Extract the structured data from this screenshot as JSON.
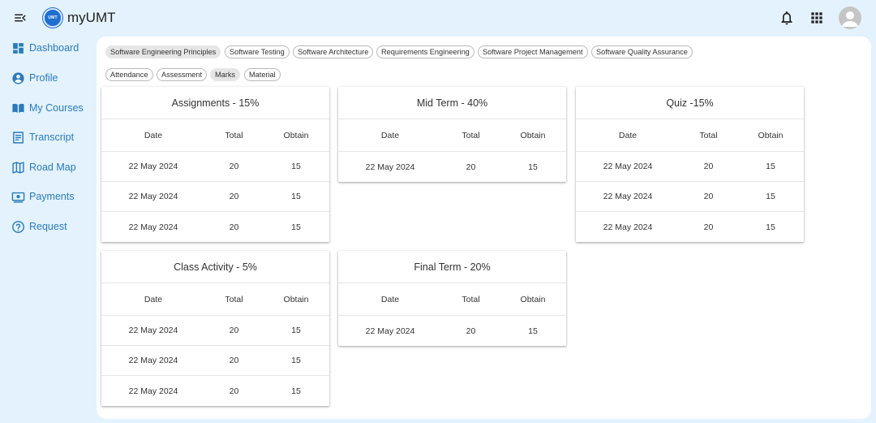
{
  "app": {
    "title": "myUMT",
    "logo_text": "UMT"
  },
  "topbar": {
    "icons": [
      "menu-toggle-icon",
      "bell-icon",
      "apps-grid-icon",
      "account-icon"
    ]
  },
  "sidebar": {
    "items": [
      {
        "label": "Dashboard",
        "icon": "dashboard-icon"
      },
      {
        "label": "Profile",
        "icon": "profile-icon"
      },
      {
        "label": "My Courses",
        "icon": "book-icon"
      },
      {
        "label": "Transcript",
        "icon": "transcript-icon"
      },
      {
        "label": "Road Map",
        "icon": "map-icon"
      },
      {
        "label": "Payments",
        "icon": "payments-icon"
      },
      {
        "label": "Request",
        "icon": "help-icon"
      }
    ]
  },
  "courses": [
    {
      "label": "Software Engineering Principles",
      "active": true
    },
    {
      "label": "Software Testing",
      "active": false
    },
    {
      "label": "Software Architecture",
      "active": false
    },
    {
      "label": "Requirements Engineering",
      "active": false
    },
    {
      "label": "Software Project Management",
      "active": false
    },
    {
      "label": "Software Quality Assurance",
      "active": false
    }
  ],
  "sections": [
    {
      "label": "Attendance",
      "active": false
    },
    {
      "label": "Assessment",
      "active": false
    },
    {
      "label": "Marks",
      "active": true
    },
    {
      "label": "Material",
      "active": false
    }
  ],
  "table_headers": {
    "date": "Date",
    "total": "Total",
    "obtain": "Obtain"
  },
  "cards": {
    "assignments": {
      "title": "Assignments - 15%",
      "rows": [
        {
          "date": "22 May 2024",
          "total": "20",
          "obtain": "15"
        },
        {
          "date": "22 May 2024",
          "total": "20",
          "obtain": "15"
        },
        {
          "date": "22 May 2024",
          "total": "20",
          "obtain": "15"
        }
      ]
    },
    "midterm": {
      "title": "Mid Term - 40%",
      "rows": [
        {
          "date": "22 May 2024",
          "total": "20",
          "obtain": "15"
        }
      ]
    },
    "quiz": {
      "title": "Quiz -15%",
      "rows": [
        {
          "date": "22 May 2024",
          "total": "20",
          "obtain": "15"
        },
        {
          "date": "22 May 2024",
          "total": "20",
          "obtain": "15"
        },
        {
          "date": "22 May 2024",
          "total": "20",
          "obtain": "15"
        }
      ]
    },
    "class_activity": {
      "title": "Class Activity - 5%",
      "rows": [
        {
          "date": "22 May 2024",
          "total": "20",
          "obtain": "15"
        },
        {
          "date": "22 May 2024",
          "total": "20",
          "obtain": "15"
        },
        {
          "date": "22 May 2024",
          "total": "20",
          "obtain": "15"
        }
      ]
    },
    "final_term": {
      "title": "Final Term - 20%",
      "rows": [
        {
          "date": "22 May 2024",
          "total": "20",
          "obtain": "15"
        }
      ]
    }
  },
  "colors": {
    "accent": "#2b7bb9",
    "background": "#e3f2fd",
    "panel": "#ffffff"
  }
}
